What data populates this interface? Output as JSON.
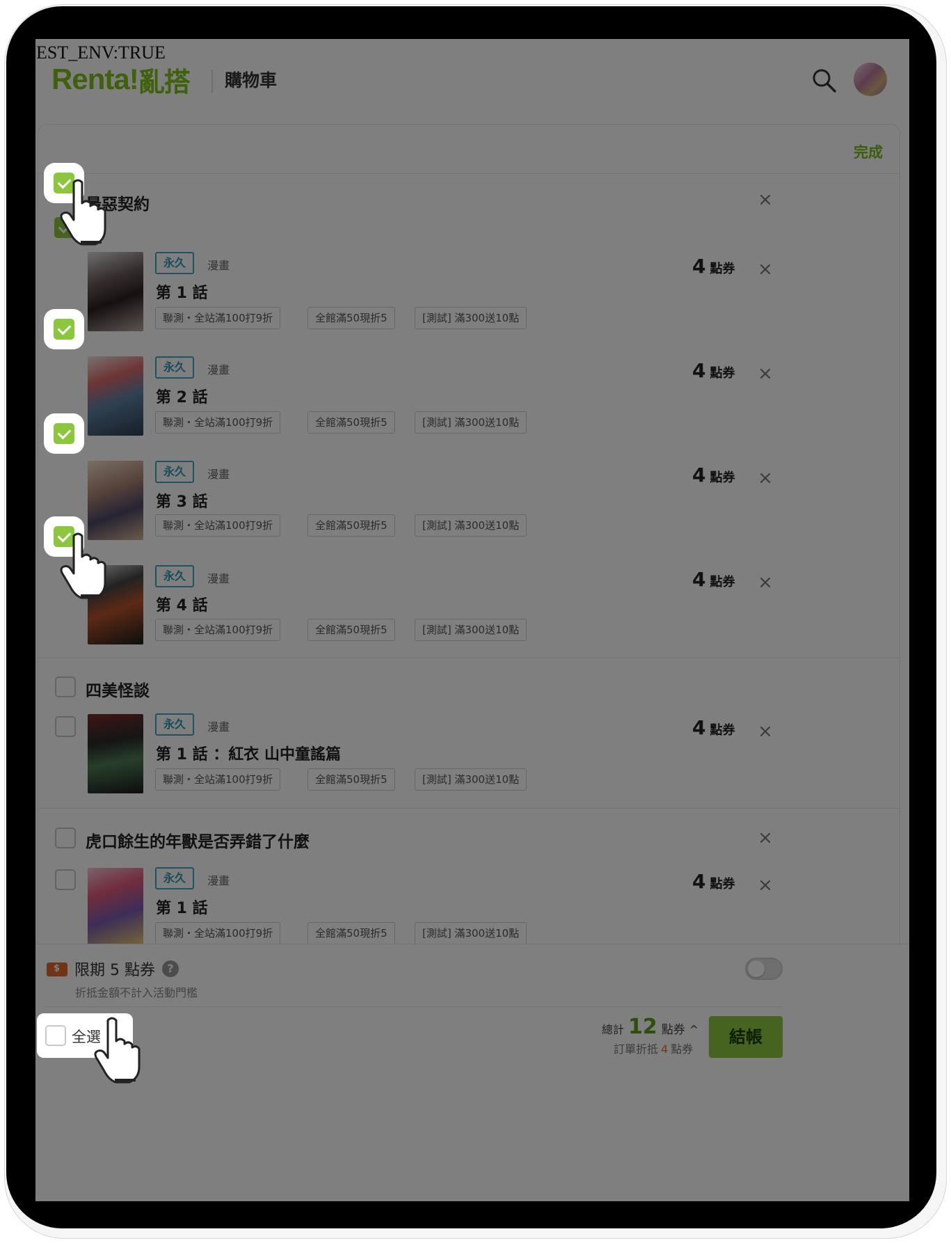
{
  "env_label": "EST_ENV:TRUE",
  "header": {
    "logo_text": "Renta!",
    "logo_zh": "亂搭",
    "page_title": "購物車",
    "search_icon": "search-icon",
    "avatar": "user-avatar"
  },
  "edit": {
    "done_label": "完成"
  },
  "series": [
    {
      "title": "最惡契約",
      "checked": true,
      "items": [
        {
          "license": "永久",
          "category": "漫畫",
          "episode": "第 1 話",
          "price": "4",
          "unit": "點券",
          "checked": true,
          "promos": [
            "聯測・全站滿100打9折",
            "全館滿50現折5",
            "[測試] 滿300送10點"
          ]
        },
        {
          "license": "永久",
          "category": "漫畫",
          "episode": "第 2 話",
          "price": "4",
          "unit": "點券",
          "checked": true,
          "promos": [
            "聯測・全站滿100打9折",
            "全館滿50現折5",
            "[測試] 滿300送10點"
          ]
        },
        {
          "license": "永久",
          "category": "漫畫",
          "episode": "第 3 話",
          "price": "4",
          "unit": "點券",
          "checked": true,
          "promos": [
            "聯測・全站滿100打9折",
            "全館滿50現折5",
            "[測試] 滿300送10點"
          ]
        },
        {
          "license": "永久",
          "category": "漫畫",
          "episode": "第 4 話",
          "price": "4",
          "unit": "點券",
          "checked": true,
          "promos": [
            "聯測・全站滿100打9折",
            "全館滿50現折5",
            "[測試] 滿300送10點"
          ]
        }
      ]
    },
    {
      "title": "四美怪談",
      "checked": false,
      "items": [
        {
          "license": "永久",
          "category": "漫畫",
          "episode": "第 1 話 ：紅衣 山中童謠篇",
          "price": "4",
          "unit": "點券",
          "checked": false,
          "promos": [
            "聯測・全站滿100打9折",
            "全館滿50現折5",
            "[測試] 滿300送10點"
          ]
        }
      ]
    },
    {
      "title": "虎口餘生的年獸是否弄錯了什麼",
      "checked": false,
      "items": [
        {
          "license": "永久",
          "category": "漫畫",
          "episode": "第 1 話",
          "price": "4",
          "unit": "點券",
          "checked": false,
          "promos": [
            "聯測・全站滿100打9折",
            "全館滿50現折5",
            "[測試] 滿300送10點"
          ]
        }
      ]
    }
  ],
  "coupon": {
    "label": "限期 5 點券",
    "note": "折抵金額不計入活動門檻",
    "enabled": false
  },
  "footer": {
    "select_all": "全選",
    "total_label": "總計",
    "total_value": "12",
    "total_unit": "點券",
    "caret": "^",
    "discount_label": "訂單折抵",
    "discount_value": "4",
    "discount_unit": "點券",
    "checkout": "結帳"
  }
}
